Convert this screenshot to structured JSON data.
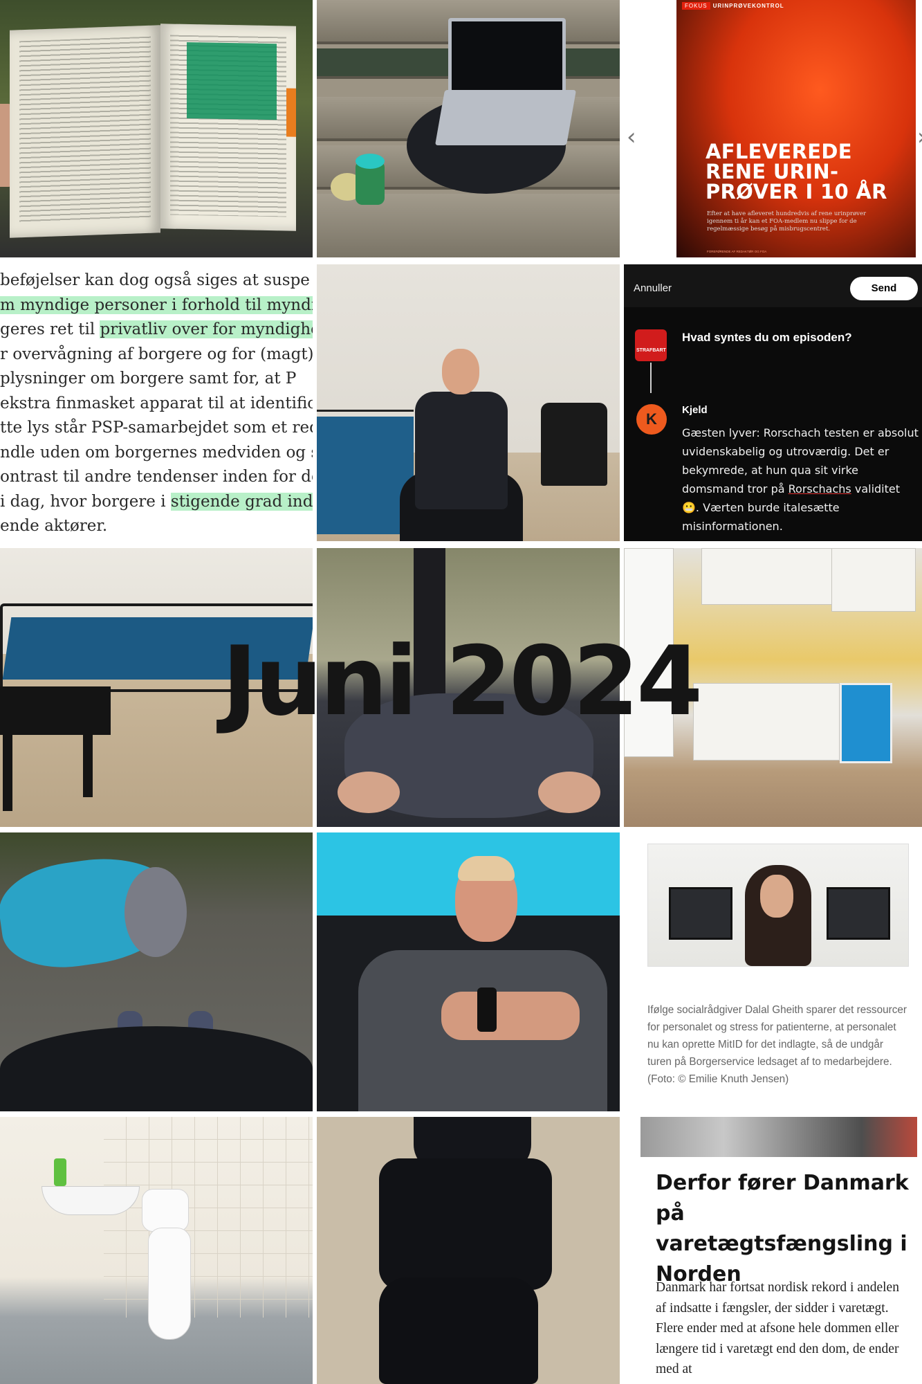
{
  "overlay_title": "Juni 2024",
  "magazine": {
    "section_tag": "FOKUS",
    "section_name": "URINPRØVEKONTROL",
    "headline_lines": [
      "AFLEVEREDE",
      "RENE URIN-",
      "PRØVER I 10 ÅR"
    ],
    "lead": "Efter at have afleveret hundredvis af rene urinprøver igennem ti år kan et FOA-medlem nu slippe for de regelmæssige besøg på misbrugscentret.",
    "footer": "FOREFØRENDE AF REDAKTØR OG FOA"
  },
  "highlighted_text": {
    "lines": [
      {
        "before": "beføjelser kan dog også siges at suspe",
        "hl": "",
        "after": ""
      },
      {
        "before": "",
        "hl": "m myndige personer i forhold til myndi",
        "after": ""
      },
      {
        "before": "geres ret til ",
        "hl": "privatliv over for myndighede",
        "after": ""
      },
      {
        "before": "r overvågning af borgere og for (magt)mi",
        "hl": "",
        "after": ""
      },
      {
        "before": "plysninger om borgere samt for, at P",
        "hl": "",
        "after": ""
      },
      {
        "before": " ekstra finmasket apparat til at identific",
        "hl": "",
        "after": ""
      },
      {
        "before": "tte lys står PSP-samarbejdet som et redsk",
        "hl": "",
        "after": ""
      },
      {
        "before": "ndle uden om borgernes medviden og sa",
        "hl": "",
        "after": ""
      },
      {
        "before": "ontrast til andre tendenser inden for de",
        "hl": "",
        "after": ""
      },
      {
        "before": " i dag, hvor borgere i ",
        "hl": "stigende grad indd",
        "after": ""
      },
      {
        "before": "ende aktører.",
        "hl": "",
        "after": ""
      }
    ]
  },
  "comment_app": {
    "cancel_label": "Annuller",
    "send_label": "Send",
    "show_logo_text": "STRAFBART",
    "question": "Hvad syntes du om episoden?",
    "avatar_letter": "K",
    "commenter": "Kjeld",
    "comment_part1": "Gæsten lyver: Rorschach testen er absolut uvidenskabelig og utroværdig. Det er bekymrede, at hun qua sit virke domsmand tror på ",
    "comment_link": "Rorschachs",
    "comment_part2": " validitet 😬. Værten burde italesætte misinformationen."
  },
  "news_photo": {
    "caption": "Ifølge socialrådgiver Dalal Gheith sparer det ressourcer for personalet og stress for patienterne, at personalet nu kan oprette MitID for det indlagte, så de undgår turen på Borgerservice ledsaget af to medarbejdere. (Foto: © Emilie Knuth Jensen)"
  },
  "article": {
    "headline": "Derfor fører Danmark på varetægtsfængsling i Norden",
    "body": "Danmark har fortsat nordisk rekord i andelen af indsatte i fængsler, der sidder i varetægt. Flere ender med at afsone hele dommen eller længere tid i varetægt end den dom, de ender med at"
  },
  "colors": {
    "highlight": "#b8f0c8",
    "app_background": "#0b0b0b",
    "avatar": "#ee5a1e",
    "magazine_red": "#d8330c"
  }
}
